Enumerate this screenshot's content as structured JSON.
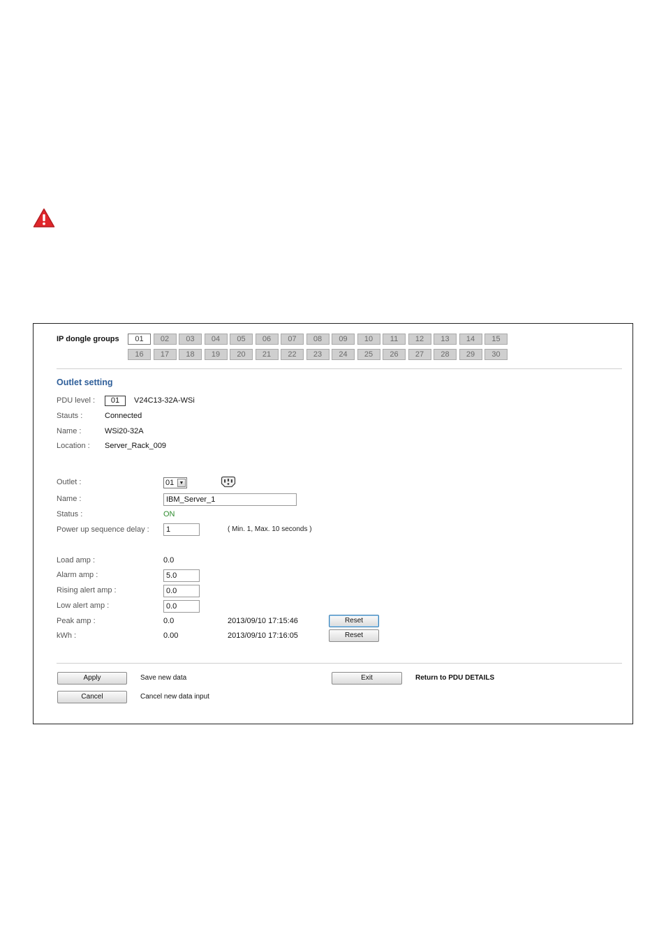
{
  "groups": {
    "label": "IP dongle groups",
    "row1": [
      "01",
      "02",
      "03",
      "04",
      "05",
      "06",
      "07",
      "08",
      "09",
      "10",
      "11",
      "12",
      "13",
      "14",
      "15"
    ],
    "row2": [
      "16",
      "17",
      "18",
      "19",
      "20",
      "21",
      "22",
      "23",
      "24",
      "25",
      "26",
      "27",
      "28",
      "29",
      "30"
    ],
    "selected": "01"
  },
  "outlet_setting": {
    "title": "Outlet setting",
    "pdu_level_label": "PDU level :",
    "pdu_level_value": "01",
    "pdu_model": "V24C13-32A-WSi",
    "status_label": "Stauts :",
    "status_value": "Connected",
    "name_label": "Name :",
    "name_value": "WSi20-32A",
    "location_label": "Location :",
    "location_value": "Server_Rack_009"
  },
  "outlet": {
    "outlet_label": "Outlet :",
    "outlet_value": "01",
    "name_label": "Name :",
    "name_value": "IBM_Server_1",
    "status_label": "Status :",
    "status_value": "ON",
    "delay_label": "Power up sequence delay :",
    "delay_value": "1",
    "delay_note": "( Min. 1, Max. 10 seconds )"
  },
  "measurements": {
    "load_label": "Load amp :",
    "load_value": "0.0",
    "alarm_label": "Alarm amp :",
    "alarm_value": "5.0",
    "rising_label": "Rising alert amp :",
    "rising_value": "0.0",
    "low_label": "Low alert amp :",
    "low_value": "0.0",
    "peak_label": "Peak amp :",
    "peak_value": "0.0",
    "peak_time": "2013/09/10 17:15:46",
    "kwh_label": "kWh :",
    "kwh_value": "0.00",
    "kwh_time": "2013/09/10 17:16:05",
    "reset_label": "Reset"
  },
  "actions": {
    "apply_label": "Apply",
    "apply_desc": "Save new data",
    "cancel_label": "Cancel",
    "cancel_desc": "Cancel new data input",
    "exit_label": "Exit",
    "exit_desc": "Return to PDU DETAILS"
  },
  "colors": {
    "accent": "#2f5f9a",
    "status_on": "#2e8b2e",
    "warning": "#e0262b"
  },
  "icons": [
    "warning-icon",
    "outlet-socket-icon",
    "chevron-down-icon"
  ]
}
